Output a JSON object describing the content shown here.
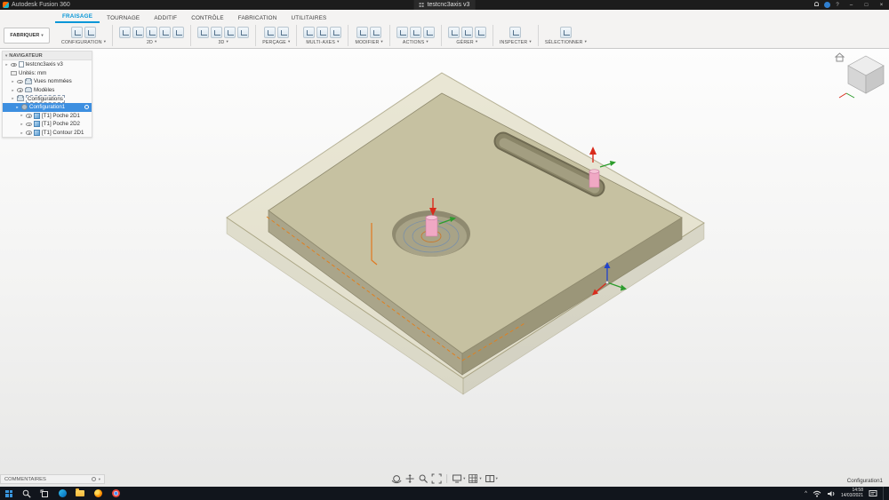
{
  "glyphs": {
    "caret": "▾",
    "arrow": "▸",
    "tri": "▾",
    "minimize": "–",
    "maximize": "□",
    "close": "×",
    "help": "?",
    "chevron_up": "^"
  },
  "colors": {
    "accent_blue": "#0696d7",
    "selection_blue": "#3d8fe0",
    "part_tan": "#c6c1a1",
    "stock_translucent": "#d2cda5",
    "tool_pink": "#f0a8c4",
    "toolpath_orange": "#e08020"
  },
  "titlebar": {
    "app_title": "Autodesk Fusion 360",
    "document_title": "testcnc3axis v3"
  },
  "ribbon": {
    "workspace_selector": "FABRIQUER",
    "tabs": [
      {
        "label": "FRAISAGE"
      },
      {
        "label": "TOURNAGE"
      },
      {
        "label": "ADDITIF"
      },
      {
        "label": "CONTRÔLE"
      },
      {
        "label": "FABRICATION"
      },
      {
        "label": "UTILITAIRES"
      }
    ],
    "groups": [
      {
        "label": "CONFIGURATION"
      },
      {
        "label": "2D"
      },
      {
        "label": "3D"
      },
      {
        "label": "PERÇAGE"
      },
      {
        "label": "MULTI-AXES"
      },
      {
        "label": "MODIFIER"
      },
      {
        "label": "ACTIONS"
      },
      {
        "label": "GÉRER"
      },
      {
        "label": "INSPECTER"
      },
      {
        "label": "SÉLECTIONNER"
      }
    ]
  },
  "navigator": {
    "title": "NAVIGATEUR",
    "items": [
      {
        "label": "testcnc3axis v3"
      },
      {
        "label": "Unités: mm"
      },
      {
        "label": "Vues nommées"
      },
      {
        "label": "Modèles"
      },
      {
        "label": "Configurations"
      },
      {
        "label": "Configuration1"
      },
      {
        "label": "[T1] Poche 2D1"
      },
      {
        "label": "[T1] Poche 2D2"
      },
      {
        "label": "[T1] Contour 2D1"
      }
    ]
  },
  "viewport": {
    "status_config": "Configuration1"
  },
  "comments": {
    "label": "COMMENTAIRES"
  },
  "taskbar": {
    "time": "14:58",
    "date": "14/03/2021"
  }
}
